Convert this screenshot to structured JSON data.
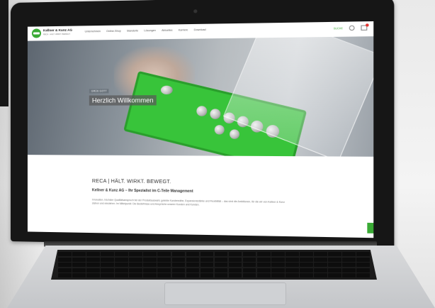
{
  "site": {
    "brand_name": "Kellner & Kunz AG",
    "brand_tagline": "RECA · HÄLT. WIRKT. BEWEGT.",
    "nav_items": [
      "Unternehmen",
      "Online-Shop",
      "Standorte",
      "Lösungen",
      "Aktuelles",
      "Karriere",
      "Download"
    ],
    "search_label": "SUCHE"
  },
  "hero": {
    "kicker": "GRÜß GOTT",
    "title": "Herzlich Willkommen"
  },
  "intro": {
    "title": "RECA | HÄLT. WIRKT. BEWEGT.",
    "subtitle": "Kellner & Kunz AG – Ihr Spezialist im C-Teile Management",
    "body": "Innovation, höchster Qualitätsanspruch bei der Produktauswahl, gelebte Kundennähe, Expansionsstärke und Flexibilität – das sind die Ambitionen, für die wir von Kellner & Kunz stehen und einstehen. Im Mittelpunkt: Die Bedürfnisse und Ansprüche unserer Kunden und Kunden."
  },
  "colors": {
    "brand_green": "#3aaa35",
    "laptop_bezel": "#161616"
  }
}
